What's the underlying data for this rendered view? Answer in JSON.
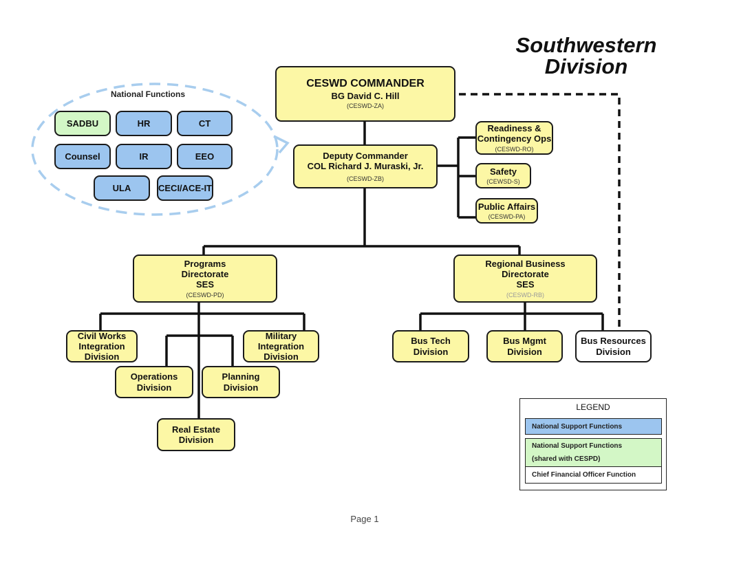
{
  "title": [
    "Southwestern",
    "Division"
  ],
  "national_functions": {
    "title": "National Functions",
    "items": [
      {
        "label": "SADBU",
        "category": "shared"
      },
      {
        "label": "HR",
        "category": "national"
      },
      {
        "label": "CT",
        "category": "national"
      },
      {
        "label": "Counsel",
        "category": "national"
      },
      {
        "label": "IR",
        "category": "national"
      },
      {
        "label": "EEO",
        "category": "national"
      },
      {
        "label": "ULA",
        "category": "national"
      },
      {
        "label": "CECI/ACE-IT",
        "category": "national"
      }
    ]
  },
  "commander": {
    "title": "CESWD COMMANDER",
    "name": "BG David C. Hill",
    "code": "(CESWD-ZA)"
  },
  "deputy": {
    "title": "Deputy Commander",
    "name": "COL Richard J. Muraski, Jr.",
    "code": "(CESWD-ZB)"
  },
  "staff": [
    {
      "lines": [
        "Readiness &",
        "Contingency Ops"
      ],
      "code": "(CESWD-RO)"
    },
    {
      "lines": [
        "Safety"
      ],
      "code": "(CEWSD-S)"
    },
    {
      "lines": [
        "Public Affairs"
      ],
      "code": "(CESWD-PA)"
    }
  ],
  "directorates": [
    {
      "lines": [
        "Programs",
        "Directorate",
        "SES"
      ],
      "code": "(CESWD-PD)"
    },
    {
      "lines": [
        "Regional Business",
        "Directorate",
        "SES"
      ],
      "code": "(CESWD-RB)"
    }
  ],
  "programs_divisions": [
    {
      "lines": [
        "Civil Works",
        "Integration",
        "Division"
      ]
    },
    {
      "lines": [
        "Military",
        "Integration",
        "Division"
      ]
    },
    {
      "lines": [
        "Operations",
        "Division"
      ]
    },
    {
      "lines": [
        "Planning",
        "Division"
      ]
    },
    {
      "lines": [
        "Real Estate",
        "Division"
      ]
    }
  ],
  "business_divisions": [
    {
      "lines": [
        "Bus Tech",
        "Division"
      ],
      "category": "standard"
    },
    {
      "lines": [
        "Bus Mgmt",
        "Division"
      ],
      "category": "standard"
    },
    {
      "lines": [
        "Bus Resources",
        "Division"
      ],
      "category": "cfo"
    }
  ],
  "legend": {
    "title": "LEGEND",
    "items": [
      {
        "lines": [
          "National Support Functions"
        ],
        "color": "#9cc5ef"
      },
      {
        "lines": [
          "National Support Functions",
          "(shared with CESPD)"
        ],
        "color": "#d3f7c6"
      },
      {
        "lines": [
          "Chief Financial Officer Function"
        ],
        "color": "#ffffff"
      }
    ]
  },
  "colors": {
    "unit": "#fcf7a5",
    "national": "#9cc5ef",
    "shared": "#d3f7c6",
    "cfo": "#ffffff",
    "ellipse": "#a8cdee"
  },
  "footer": "Page 1"
}
